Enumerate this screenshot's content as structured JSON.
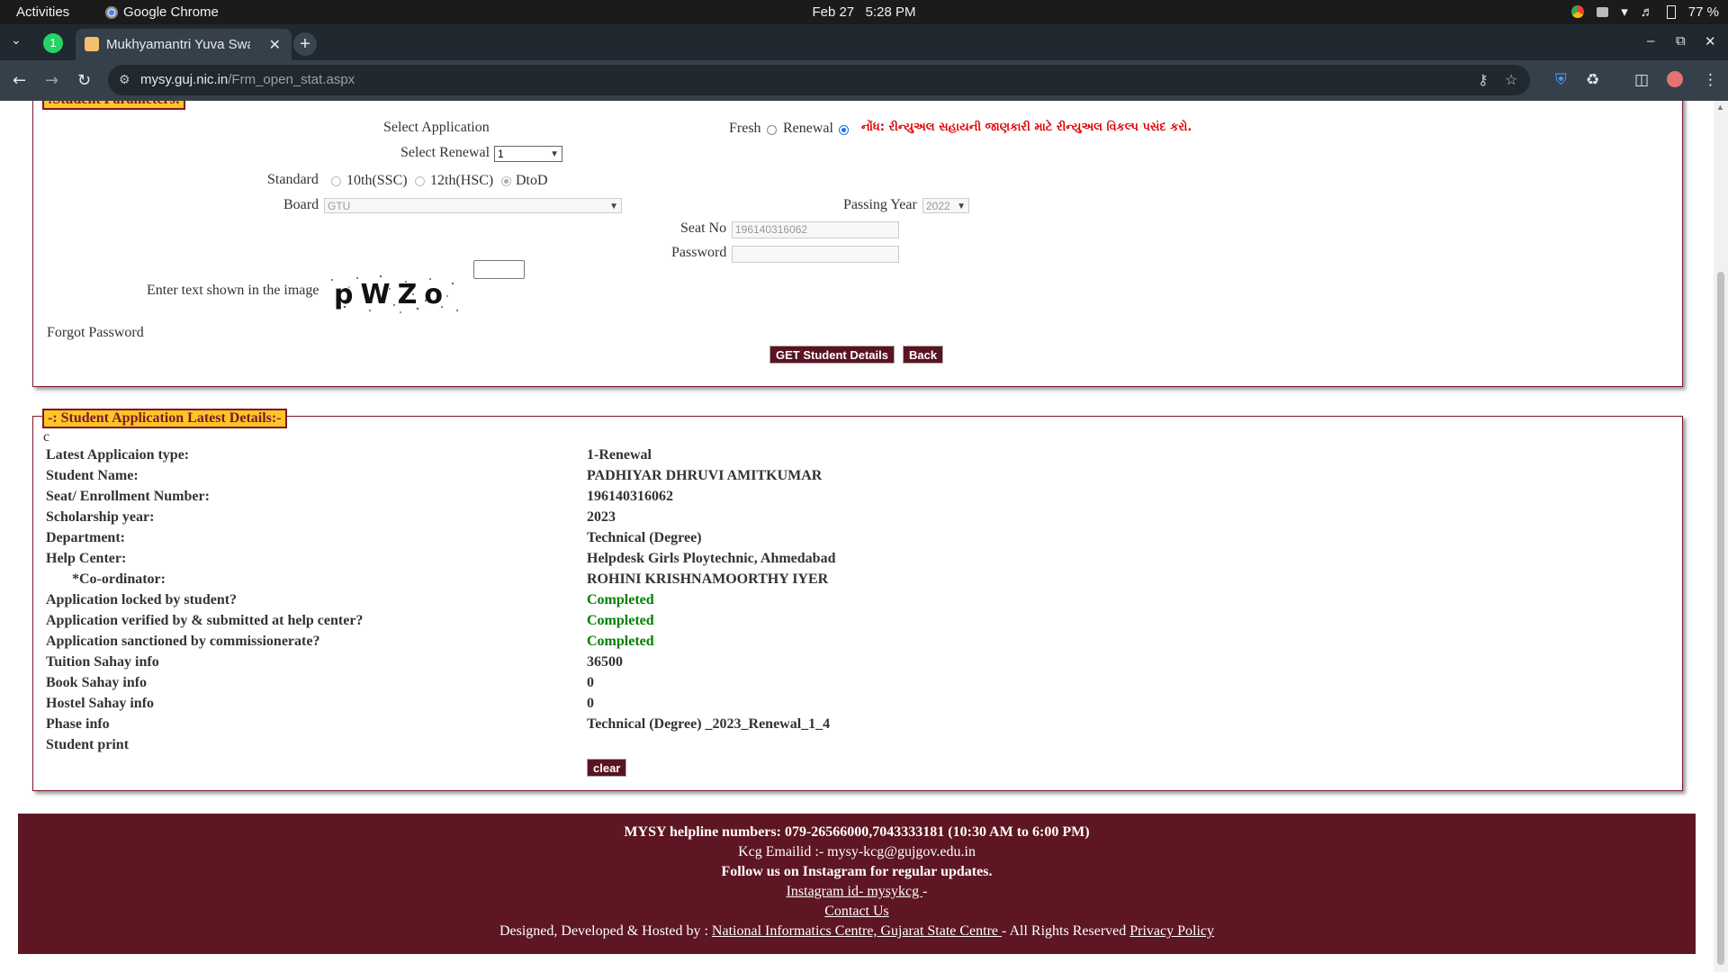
{
  "os": {
    "activities": "Activities",
    "app_name": "Google Chrome",
    "clock_date": "Feb 27",
    "clock_time": "5:28 PM",
    "battery": "77 %"
  },
  "browser": {
    "tab_title": "Mukhyamantri Yuva Swa",
    "url_host": "mysy.guj.nic.in",
    "url_path": "/Frm_open_stat.aspx",
    "whatsapp_badge": "1"
  },
  "student_params": {
    "legend": ":Student Parameters:",
    "select_application_label": "Select Application",
    "fresh_label": "Fresh",
    "renewal_label": "Renewal",
    "application_selected": "Renewal",
    "note": "નોંધ: રીન્યુઅલ સહાયની જાણકારી માટે રીન્યુઅલ વિકલ્પ પસંદ કરો.",
    "select_renewal_label": "Select Renewal",
    "select_renewal_value": "1",
    "standard_label": "Standard",
    "std_10": "10th(SSC)",
    "std_12": "12th(HSC)",
    "std_dtod": "DtoD",
    "standard_selected": "DtoD",
    "board_label": "Board",
    "board_value": "GTU",
    "passing_year_label": "Passing Year",
    "passing_year_value": "2022",
    "seat_no_label": "Seat No",
    "seat_no_value": "196140316062",
    "password_label": "Password",
    "password_value": "",
    "captcha_label": "Enter text shown in the image",
    "captcha_text": "pWZo",
    "captcha_input_value": "",
    "forgot_password": "Forgot Password",
    "get_details_button": "GET Student Details",
    "back_button": "Back"
  },
  "latest_details": {
    "legend": "-: Student Application Latest Details:-",
    "stray_text": "c",
    "rows": [
      {
        "label": "Latest Applicaion type:",
        "value": "1-Renewal",
        "status": false
      },
      {
        "label": "Student Name:",
        "value": "PADHIYAR DHRUVI AMITKUMAR",
        "status": false
      },
      {
        "label": "Seat/ Enrollment Number:",
        "value": "196140316062",
        "status": false
      },
      {
        "label": "Scholarship year:",
        "value": "2023",
        "status": false
      },
      {
        "label": "Department:",
        "value": "Technical (Degree)",
        "status": false
      },
      {
        "label": "Help Center:",
        "value": "Helpdesk Girls Ploytechnic, Ahmedabad",
        "status": false
      },
      {
        "label": "*Co-ordinator:",
        "value": "ROHINI KRISHNAMOORTHY IYER",
        "status": false
      },
      {
        "label": "Application locked by student?",
        "value": "Completed",
        "status": true
      },
      {
        "label": "Application verified by & submitted at help center?",
        "value": "Completed",
        "status": true
      },
      {
        "label": "Application sanctioned by commissionerate?",
        "value": "Completed",
        "status": true
      },
      {
        "label": "Tuition Sahay info",
        "value": "36500",
        "status": false
      },
      {
        "label": "Book Sahay info",
        "value": "0",
        "status": false
      },
      {
        "label": "Hostel Sahay info",
        "value": "0",
        "status": false
      },
      {
        "label": "Phase info",
        "value": "Technical (Degree) _2023_Renewal_1_4",
        "status": false
      },
      {
        "label": "Student print",
        "value": "",
        "status": false
      }
    ],
    "clear_button": "clear"
  },
  "footer": {
    "helpline": "MYSY helpline numbers: 079-26566000,7043333181 (10:30 AM to 6:00 PM)",
    "email": "Kcg Emailid :- mysy-kcg@gujgov.edu.in",
    "follow": "Follow us on Instagram for regular updates.",
    "instagram_link": "Instagram id- mysykcg ",
    "instagram_dash": "-",
    "contact_link": "Contact Us",
    "designed_prefix": "Designed, Developed & Hosted by : ",
    "nic_link": "National Informatics Centre, Gujarat State Centre ",
    "rights": " - All Rights Reserved ",
    "privacy_link": "Privacy Policy"
  },
  "colors": {
    "brand_maroon": "#5d1622",
    "legend_yellow": "#ffc426",
    "status_green": "#008000",
    "note_red": "#e00000"
  },
  "icons": [
    "whatsapp-icon",
    "chrome-icon",
    "back-icon",
    "forward-icon",
    "reload-icon",
    "key-icon",
    "star-icon",
    "extensions-icon",
    "sidepanel-icon",
    "profile-icon",
    "menu-icon"
  ]
}
